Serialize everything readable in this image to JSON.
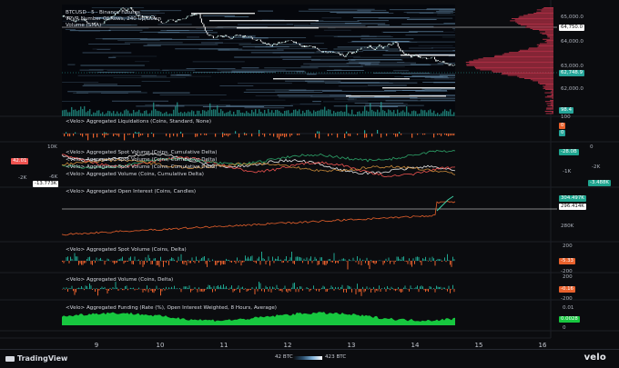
{
  "header": {
    "line1": "BTCUSD · 5 · Binance Futures",
    "line2": "VPVR Number Of Rows, 240 Up/Down",
    "line3": "Volume (SMA)"
  },
  "panes": {
    "liquidations": "<Velo> Aggregated Liquidations (Coins, Standard, None)",
    "spot_cvd": "<Velo> Aggregated Spot Volume (Coins, Cumulative Delta)",
    "spot_cvd2": "<Velo> Aggregated Spot Volume (Coins, Cumulative Delta)",
    "spot_cvd3": "<Velo> Aggregated Spot Volume (Coins, Cumulative Delta)",
    "perp_cvd": "<Velo> Aggregated Volume (Coins, Cumulative Delta)",
    "open_interest": "<Velo> Aggregated Open Interest (Coins, Candles)",
    "spot_delta": "<Velo> Aggregated Spot Volume (Coins, Delta)",
    "perp_delta": "<Velo> Aggregated Volume (Coins, Delta)",
    "funding": "<Velo> Aggregated Funding (Rate (%), Open Interest Weighted, 8 Hours, Average)"
  },
  "price_axis": {
    "ticks": [
      "65,000.0",
      "64,000.0",
      "63,000.0",
      "62,000.0"
    ],
    "high_badge": "64,750.0",
    "last_badge": "62,748.9",
    "bottom_badge": "98.4"
  },
  "liq_axis": {
    "ticks": [
      "100",
      "0"
    ],
    "badge_a": "0",
    "badge_b": "0"
  },
  "cvd_axis": {
    "left_ticks": [
      "10K",
      "-2K",
      "-6K"
    ],
    "left_badge_red": "42.01",
    "left_badge_value": "-13.773K",
    "right_ticks": [
      "0",
      "-1K",
      "-2K"
    ],
    "right_badge_a": "-28.0B",
    "right_badge_b": "-3.488K"
  },
  "oi_axis": {
    "ticks": [
      "280K"
    ],
    "badge_a": "304.497K",
    "badge_b": "296.414K"
  },
  "spot_delta_axis": {
    "ticks": [
      "200",
      "-200"
    ],
    "badge": "-5.33"
  },
  "perp_delta_axis": {
    "ticks": [
      "200",
      "-200"
    ],
    "badge": "-0.16"
  },
  "funding_axis": {
    "ticks": [
      "0.01",
      "0"
    ],
    "badge": "0.0028"
  },
  "x_axis": [
    "9",
    "10",
    "11",
    "12",
    "13",
    "14",
    "15",
    "16"
  ],
  "footer": {
    "brand": "TradingView",
    "heat_min": "42 BTC",
    "heat_max": "423 BTC",
    "velo": "velo"
  },
  "colors": {
    "background": "#0b0c0f",
    "up": "#26a69a",
    "down": "#ef5350",
    "orange": "#e8612c",
    "teal": "#1fa58f",
    "green_fill": "#17c73f",
    "heatmap": "#7fb1d8",
    "vpvr": "#c2334a"
  },
  "chart_data": [
    {
      "type": "line",
      "title": "BTCUSD",
      "x": [
        "9",
        "10",
        "11",
        "12",
        "13",
        "14",
        "15",
        "16"
      ],
      "series": [
        {
          "values": [
            64600,
            64900,
            64000,
            63900,
            63500,
            63300,
            62750
          ]
        }
      ],
      "ylim": [
        61800,
        65300
      ]
    },
    {
      "type": "area",
      "title": "<Velo> Aggregated Funding (Rate (%), Open Interest Weighted, 8 Hours, Average)",
      "x": [
        "9",
        "10",
        "11",
        "12",
        "13",
        "14",
        "15",
        "16"
      ],
      "series": [
        {
          "values": [
            0.004,
            0.005,
            0.004,
            0.0045,
            0.004,
            0.0035,
            0.0028
          ]
        }
      ],
      "ylim": [
        0,
        0.01
      ]
    }
  ]
}
